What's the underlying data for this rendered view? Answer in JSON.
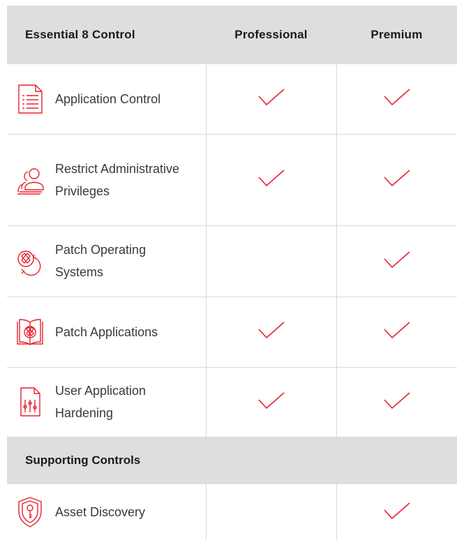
{
  "header": {
    "col_control": "Essential 8 Control",
    "col_professional": "Professional",
    "col_premium": "Premium"
  },
  "rows": [
    {
      "label": "Application Control",
      "icon": "document-list-icon",
      "professional": true,
      "premium": true
    },
    {
      "label": "Restrict Administrative Privileges",
      "icon": "users-group-icon",
      "professional": true,
      "premium": true
    },
    {
      "label": "Patch Operating Systems",
      "icon": "patch-cycle-icon",
      "professional": false,
      "premium": true
    },
    {
      "label": "Patch Applications",
      "icon": "patch-book-icon",
      "professional": true,
      "premium": true
    },
    {
      "label": "User Application Hardening",
      "icon": "file-sliders-icon",
      "professional": true,
      "premium": true
    }
  ],
  "section": {
    "label": "Supporting Controls"
  },
  "supporting_rows": [
    {
      "label": "Asset Discovery",
      "icon": "shield-key-icon",
      "professional": false,
      "premium": true
    }
  ],
  "colors": {
    "accent": "#e8212e",
    "header_bg": "#dcdee0",
    "border": "#d6d8da"
  }
}
